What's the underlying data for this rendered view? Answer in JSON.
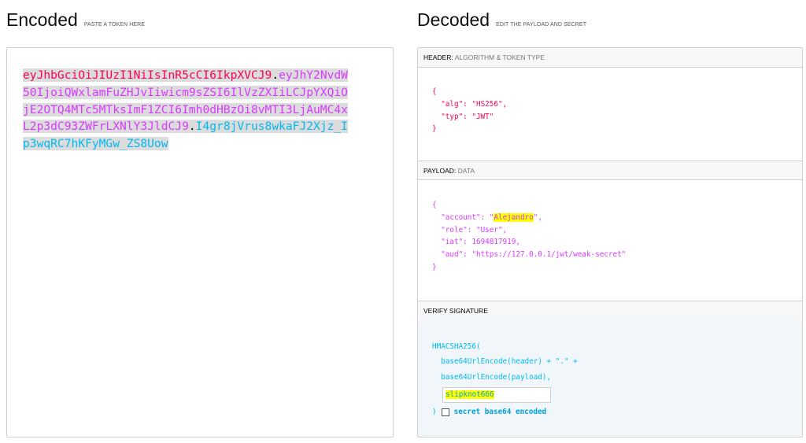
{
  "encoded": {
    "title": "Encoded",
    "subtitle": "PASTE A TOKEN HERE",
    "token_header": "eyJhbGciOiJIUzI1NiIsInR5cCI6IkpXVCJ9",
    "token_payload": "eyJhY2NvdW50IjoiQWxlamFuZHJvIiwicm9sZSI6IlVzZXIiLCJpYXQiOjE2OTQ4MTc5MTksImF1ZCI6Imh0dHBzOi8vMTI3LjAuMC4xL2p3dC93ZWFrLXNlY3JldCJ9",
    "token_signature": "I4gr8jVrus8wkaFJ2Xjz_Ip3wqRC7hKFyMGw_ZS8Uow",
    "dot": "."
  },
  "decoded": {
    "title": "Decoded",
    "subtitle": "EDIT THE PAYLOAD AND SECRET",
    "header_section": {
      "label": "HEADER:",
      "sublabel": "ALGORITHM & TOKEN TYPE",
      "open": "{",
      "line1": "  \"alg\": \"HS256\",",
      "line2": "  \"typ\": \"JWT\"",
      "close": "}"
    },
    "payload_section": {
      "label": "PAYLOAD:",
      "sublabel": "DATA",
      "open": "{",
      "account_prefix": "  \"account\": \"",
      "account_value": "Alejandro",
      "account_suffix": "\",",
      "line2": "  \"role\": \"User\",",
      "line3": "  \"iat\": 1694817919,",
      "line4": "  \"aud\": \"https://127.0.0.1/jwt/weak-secret\"",
      "close": "}"
    },
    "verify_section": {
      "label": "VERIFY SIGNATURE",
      "line1": "HMACSHA256(",
      "line2": "  base64UrlEncode(header) + \".\" +",
      "line3": "  base64UrlEncode(payload),",
      "secret_value": "slipknot666",
      "close_paren": ")",
      "checkbox_label": "secret base64 encoded",
      "checkbox_checked": false
    }
  },
  "colors": {
    "header": "#fb015b",
    "payload": "#d63aff",
    "signature": "#00b9f1",
    "highlight": "#ffff00"
  }
}
